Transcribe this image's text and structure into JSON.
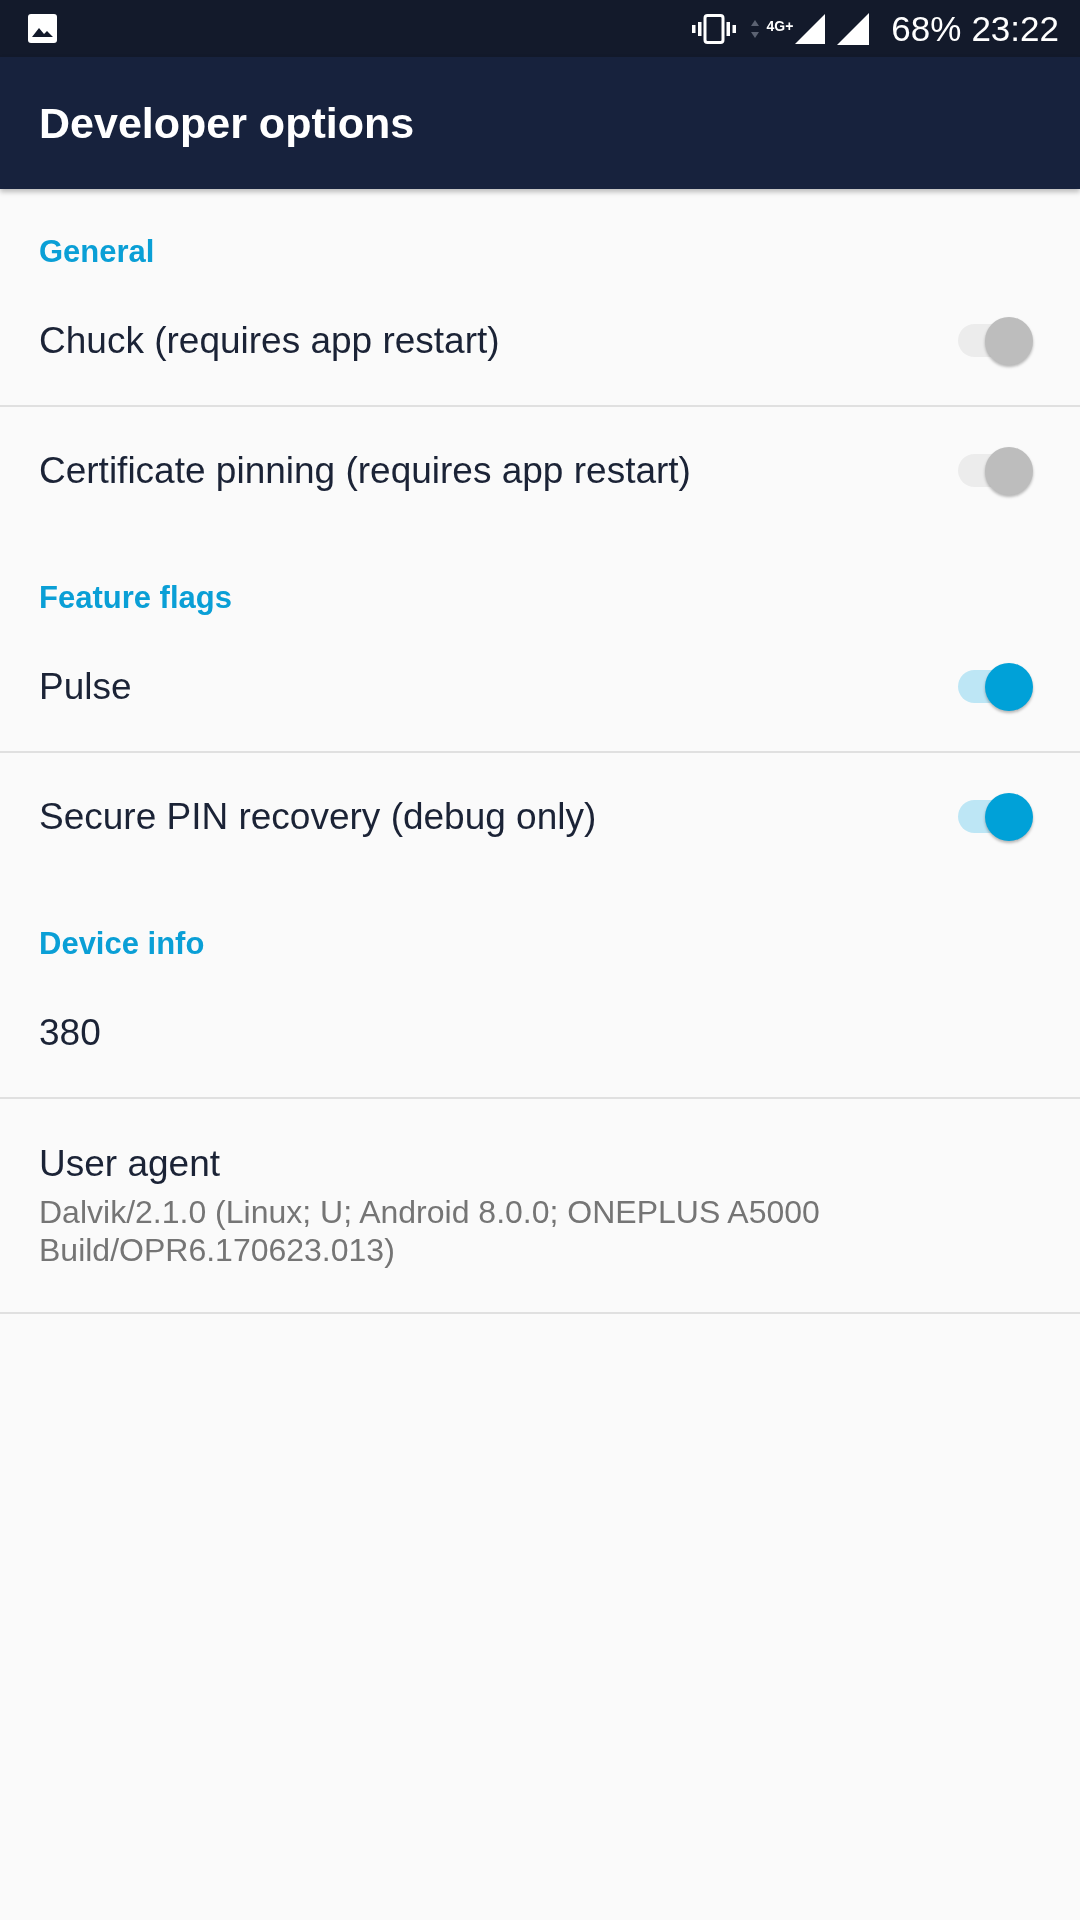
{
  "status_bar": {
    "network_type": "4G+",
    "battery": "68%",
    "time": "23:22"
  },
  "app_bar": {
    "title": "Developer options"
  },
  "sections": [
    {
      "header": "General",
      "items": [
        {
          "kind": "switch",
          "title": "Chuck (requires app restart)",
          "on": false
        },
        {
          "kind": "switch",
          "title": "Certificate pinning (requires app restart)",
          "on": false
        }
      ]
    },
    {
      "header": "Feature flags",
      "items": [
        {
          "kind": "switch",
          "title": "Pulse",
          "on": true
        },
        {
          "kind": "switch",
          "title": "Secure PIN recovery (debug only)",
          "on": true
        }
      ]
    },
    {
      "header": "Device info",
      "items": [
        {
          "kind": "info",
          "title": "380"
        },
        {
          "kind": "info",
          "title": "User agent",
          "summary": "Dalvik/2.1.0 (Linux; U; Android 8.0.0; ONEPLUS A5000 Build/OPR6.170623.013)"
        }
      ]
    }
  ]
}
